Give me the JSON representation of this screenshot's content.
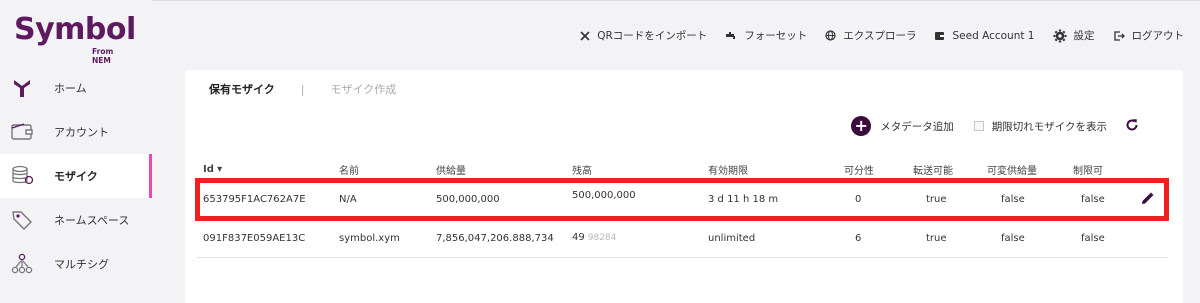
{
  "brand": {
    "name": "Symbol",
    "sub": "From NEM",
    "color": "#5d1a5f"
  },
  "sidebar": {
    "items": [
      {
        "label": "ホーム",
        "icon": "home-icon",
        "active": false
      },
      {
        "label": "アカウント",
        "icon": "wallet-icon",
        "active": false
      },
      {
        "label": "モザイク",
        "icon": "mosaic-icon",
        "active": true
      },
      {
        "label": "ネームスペース",
        "icon": "tag-icon",
        "active": false
      },
      {
        "label": "マルチシグ",
        "icon": "multisig-icon",
        "active": false
      }
    ]
  },
  "header": {
    "items": [
      {
        "label": "QRコードをインポート",
        "icon": "qr-icon"
      },
      {
        "label": "フォーセット",
        "icon": "faucet-icon"
      },
      {
        "label": "エクスプローラ",
        "icon": "globe-icon"
      },
      {
        "label": "Seed Account 1",
        "icon": "wallet-icon"
      },
      {
        "label": "設定",
        "icon": "gear-icon"
      },
      {
        "label": "ログアウト",
        "icon": "logout-icon"
      }
    ]
  },
  "tabs": {
    "active": "保有モザイク",
    "separator": "|",
    "inactive": "モザイク作成"
  },
  "actions": {
    "add_metadata": "メタデータ追加",
    "show_expired": "期限切れモザイクを表示",
    "show_expired_checked": false
  },
  "table": {
    "headers": {
      "id": "Id",
      "sort_arrow": "▾",
      "name": "名前",
      "supply": "供給量",
      "balance": "残高",
      "expiration": "有効期限",
      "divisibility": "可分性",
      "transferable": "転送可能",
      "supply_mutable": "可変供給量",
      "restrictable": "制限可"
    },
    "rows": [
      {
        "id": "653795F1AC762A7E",
        "name": "N/A",
        "supply": "500,000,000",
        "balance_main": "500,000,000",
        "balance_frac": "",
        "expiration": "3 d 11 h 18 m",
        "divisibility": "0",
        "transferable": "true",
        "supply_mutable": "false",
        "restrictable": "false",
        "highlighted": true
      },
      {
        "id": "091F837E059AE13C",
        "name": "symbol.xym",
        "supply": "7,856,047,206.888,734",
        "balance_main": "49",
        "balance_frac": "98284",
        "expiration": "unlimited",
        "divisibility": "6",
        "transferable": "true",
        "supply_mutable": "false",
        "restrictable": "false",
        "highlighted": false
      }
    ]
  },
  "colors": {
    "accent": "#e24bb8",
    "highlight": "#f0201c",
    "dark": "#3a0d3c"
  }
}
